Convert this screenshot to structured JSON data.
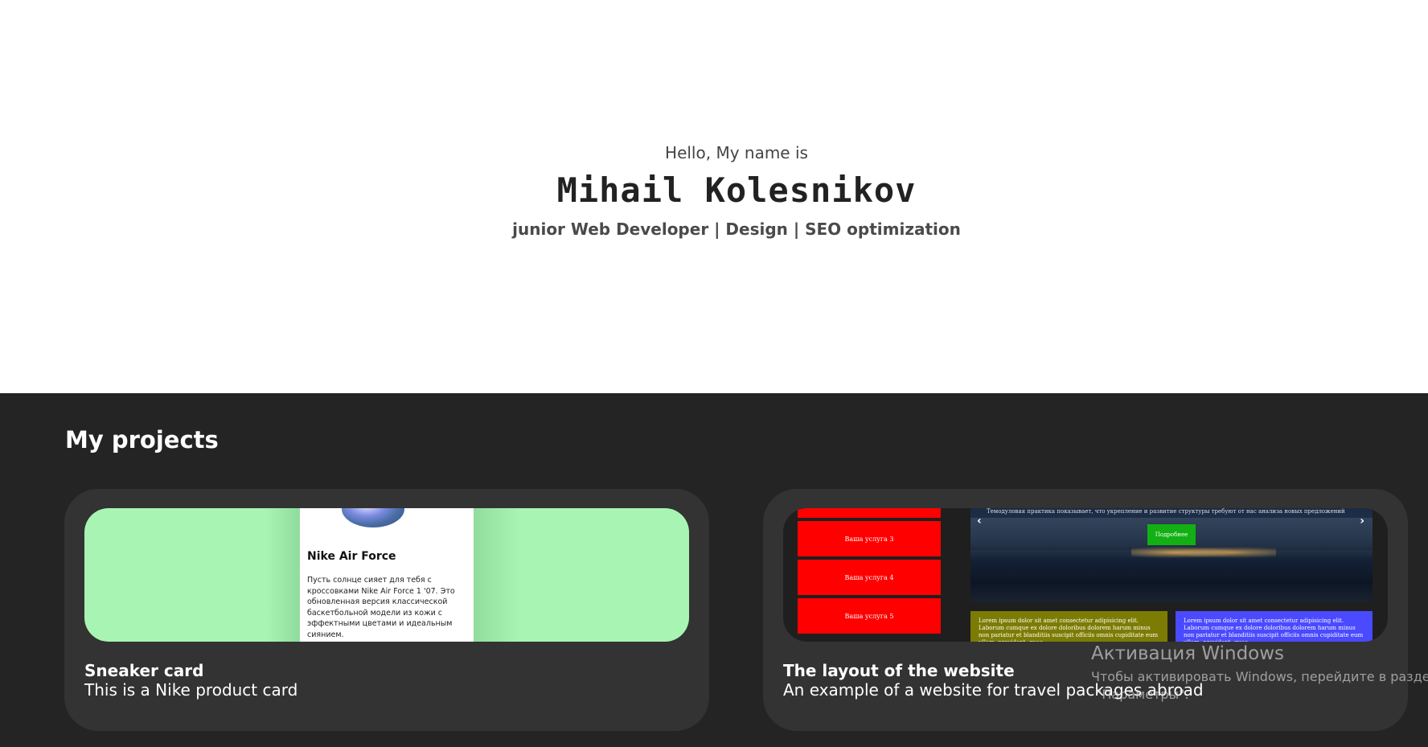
{
  "hero": {
    "greeting": "Hello, My name is",
    "name": "Mihail Kolesnikov",
    "role": "junior Web Developer | Design | SEO optimization"
  },
  "projects": {
    "title": "My projects",
    "items": [
      {
        "title": "Sneaker card",
        "description": "This is a Nike product card",
        "preview": {
          "product_name": "Nike Air Force",
          "product_text": "Пусть солнце сияет для тебя с кроссовками Nike Air Force 1 '07. Это обновленная версия классической баскетбольной модели из кожи с эффектными цветами и идеальным сиянием."
        }
      },
      {
        "title": "The layout of the website",
        "description": "An example of a website for travel packages abroad",
        "preview": {
          "services": [
            "Ваша услуга 3",
            "Ваша услуга 4",
            "Ваша услуга 5"
          ],
          "slider_button": "Подробнее",
          "slider_text": "Темодуловая практика показывает, что укрепление и развитие структуры требуют от нас анализа новых предложений",
          "info_blocks": [
            "Lorem ipsum dolor sit amet consectetur adipisicing elit. Laborum cumque ex dolore doloribus dolorem harum minus non pariatur et blanditiis suscipit officiis omnis cupiditate eum ullam, provident, quae.",
            "Lorem ipsum dolor sit amet consectetur adipisicing elit. Laborum cumque ex dolore doloribus dolorem harum minus non pariatur et blanditiis suscipit officiis omnis cupiditate eum ullam, provident, quae."
          ]
        }
      }
    ]
  },
  "watermark": {
    "title": "Активация Windows",
    "line1": "Чтобы активировать Windows, перейдите в раздел",
    "line2": "\"Параметры\"."
  },
  "colors": {
    "projects_bg": "#242424",
    "card_bg": "#333333",
    "sneaker_bg": "#a8f5b3",
    "service_red": "#ff0000",
    "slider_button": "#12b012"
  }
}
